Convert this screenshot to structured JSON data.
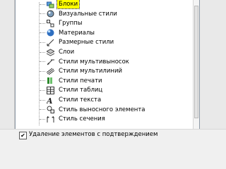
{
  "tree": {
    "items": [
      {
        "label": "Блоки",
        "icon": "blocks-icon",
        "selected": true
      },
      {
        "label": "Визуальные стили",
        "icon": "visual-styles-icon"
      },
      {
        "label": "Группы",
        "icon": "groups-icon"
      },
      {
        "label": "Материалы",
        "icon": "materials-icon"
      },
      {
        "label": "Размерные стили",
        "icon": "dimension-styles-icon"
      },
      {
        "label": "Слои",
        "icon": "layers-icon"
      },
      {
        "label": "Стили мультивыносок",
        "icon": "multileader-styles-icon"
      },
      {
        "label": "Стили мультилиний",
        "icon": "multiline-styles-icon"
      },
      {
        "label": "Стили печати",
        "icon": "plot-styles-icon"
      },
      {
        "label": "Стили таблиц",
        "icon": "table-styles-icon"
      },
      {
        "label": "Стили текста",
        "icon": "text-styles-icon"
      },
      {
        "label": "Стиль выносного элемента",
        "icon": "detail-view-style-icon"
      },
      {
        "label": "Стиль сечения",
        "icon": "section-view-style-icon"
      }
    ]
  },
  "options": {
    "confirm_delete_label": "Удаление элементов с подтверждением",
    "confirm_delete_checked": true
  },
  "colors": {
    "selection": "#ffff00"
  }
}
